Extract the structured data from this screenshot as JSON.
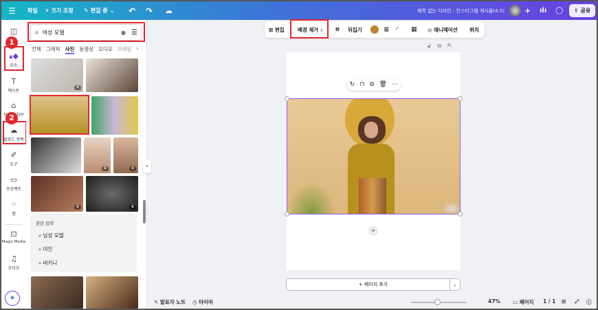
{
  "topbar": {
    "file": "파일",
    "resize": "크기 조정",
    "editing": "편집 중",
    "doc_title": "제목 없는 디자인 - 인스타그램 게시물(4:5)",
    "share": "공유"
  },
  "rail": {
    "items": [
      {
        "label": "",
        "icon": "layout-icon"
      },
      {
        "label": "요소",
        "icon": "elements-icon"
      },
      {
        "label": "텍스트",
        "icon": "text-icon"
      },
      {
        "label": "브랜드 허브",
        "icon": "brand-icon"
      },
      {
        "label": "업로드 항목",
        "icon": "upload-icon"
      },
      {
        "label": "도구",
        "icon": "draw-icon"
      },
      {
        "label": "프로젝트",
        "icon": "folder-icon"
      },
      {
        "label": "앱",
        "icon": "apps-icon"
      },
      {
        "label": "Magic Media",
        "icon": "magic-media-icon"
      },
      {
        "label": "오디오",
        "icon": "audio-icon"
      }
    ],
    "badges": [
      "1",
      "2"
    ]
  },
  "panel": {
    "search_value": "여성 모델",
    "tabs": [
      "전체",
      "그래픽",
      "사진",
      "동영상",
      "오디오",
      "프레임"
    ],
    "active_tab": "사진",
    "related_title": "관련 검색",
    "related": [
      "남성 모델",
      "미인",
      "비키니"
    ]
  },
  "toolbar": {
    "edit": "편집",
    "bg_remove": "배경 제거",
    "flip": "뒤집기",
    "animate": "애니메이션",
    "position": "위치",
    "color": "#b8862e"
  },
  "canvas": {
    "add_page": "+ 페이지 추가"
  },
  "bottom": {
    "notes": "발표자 노트",
    "timer": "타이머",
    "zoom": "47%",
    "zoom_fraction": 0.47,
    "pages": "페이지",
    "page_count": "1 / 1"
  },
  "colors": {
    "accent": "#8b5cf6",
    "highlight": "#e3262e"
  }
}
